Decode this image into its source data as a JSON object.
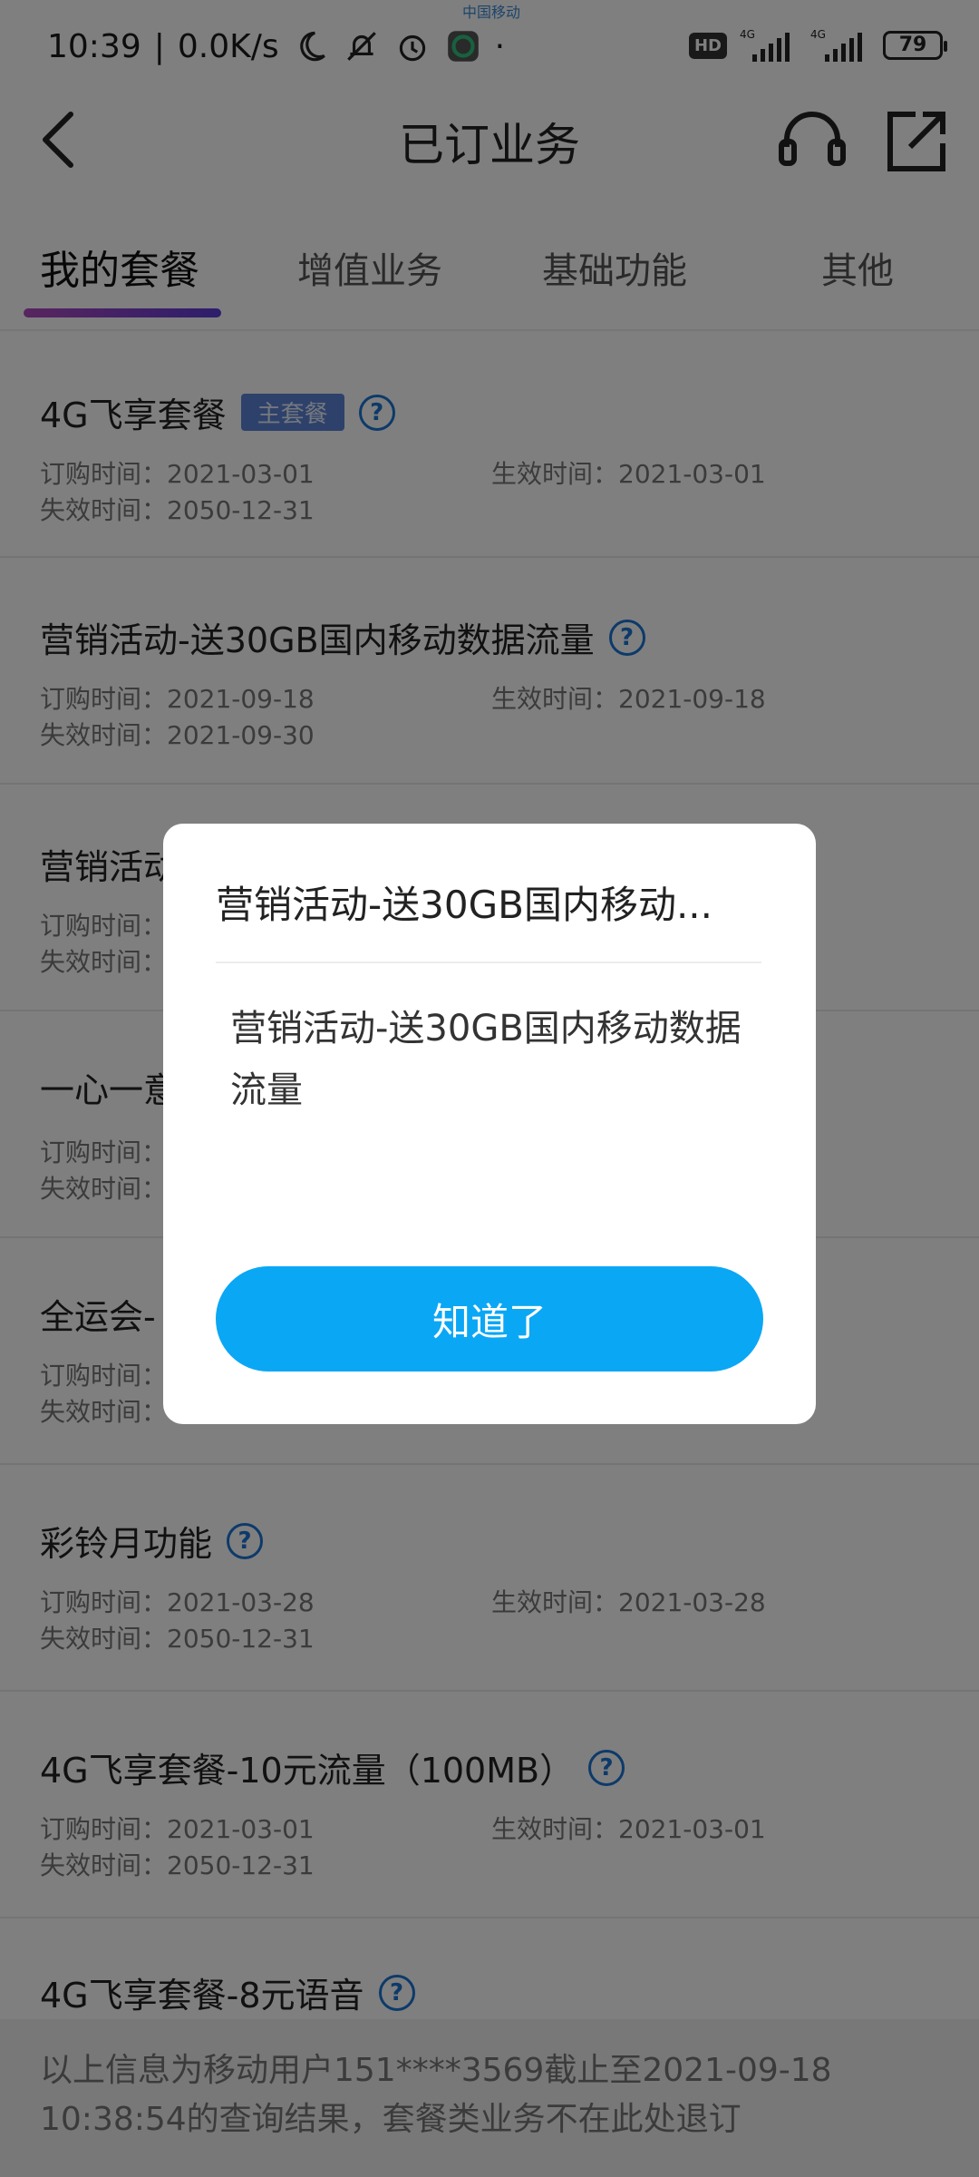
{
  "status_bar": {
    "time": "10:39",
    "speed": "0.0K/s",
    "hd": "HD",
    "net1": "4G",
    "net2": "4G",
    "battery": "79"
  },
  "header": {
    "title": "已订业务"
  },
  "tabs": [
    {
      "label": "我的套餐",
      "active": true
    },
    {
      "label": "增值业务",
      "active": false
    },
    {
      "label": "基础功能",
      "active": false
    },
    {
      "label": "其他",
      "active": false
    }
  ],
  "items": [
    {
      "title": "4G飞享套餐",
      "badge": "主套餐",
      "order_time": "订购时间：2021-03-01",
      "effective_time": "生效时间：2021-03-01",
      "expire_time": "失效时间：2050-12-31"
    },
    {
      "title": "营销活动-送30GB国内移动数据流量",
      "order_time": "订购时间：2021-09-18",
      "effective_time": "生效时间：2021-09-18",
      "expire_time": "失效时间：2021-09-30"
    },
    {
      "title": "营销活动",
      "order_time": "订购时间：",
      "expire_time": "失效时间："
    },
    {
      "title": "一心一意",
      "order_time": "订购时间：",
      "expire_time": "失效时间："
    },
    {
      "title": "全运会-",
      "order_time": "订购时间：",
      "expire_time": "失效时间："
    },
    {
      "title": "彩铃月功能",
      "order_time": "订购时间：2021-03-28",
      "effective_time": "生效时间：2021-03-28",
      "expire_time": "失效时间：2050-12-31"
    },
    {
      "title": "4G飞享套餐-10元流量（100MB）",
      "order_time": "订购时间：2021-03-01",
      "effective_time": "生效时间：2021-03-01",
      "expire_time": "失效时间：2050-12-31"
    },
    {
      "title": "4G飞享套餐-8元语音"
    }
  ],
  "footer": {
    "note": "以上信息为移动用户151****3569截止至2021-09-18 10:38:54的查询结果，套餐类业务不在此处退订"
  },
  "dialog": {
    "title": "营销活动-送30GB国内移动...",
    "body": "营销活动-送30GB国内移动数据流量",
    "ok_label": "知道了"
  },
  "colors": {
    "accent_blue": "#0aa7f5",
    "tab_indicator_start": "#b14bbf",
    "tab_indicator_end": "#5b3bd8",
    "help_icon": "#1b74d4",
    "badge_bg": "#5a82d6"
  }
}
